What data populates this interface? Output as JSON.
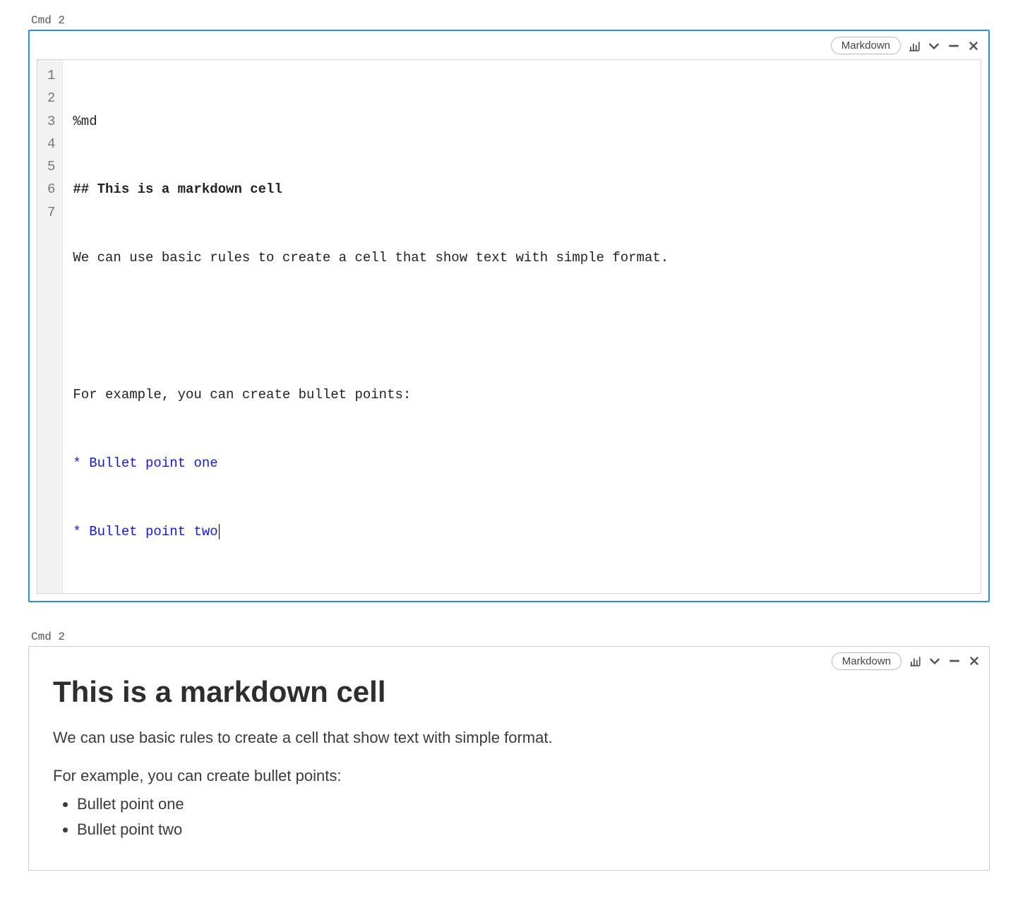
{
  "cell_editor": {
    "label": "Cmd 2",
    "language_selector": "Markdown",
    "lines": {
      "1": "%md",
      "2": "## This is a markdown cell",
      "3": "We can use basic rules to create a cell that show text with simple format.",
      "4": "",
      "5": "For example, you can create bullet points:",
      "6_prefix": "* ",
      "6_text": "Bullet point one",
      "7_prefix": "* ",
      "7_text": "Bullet point two"
    },
    "line_numbers": [
      "1",
      "2",
      "3",
      "4",
      "5",
      "6",
      "7"
    ]
  },
  "cell_rendered": {
    "label": "Cmd 2",
    "language_selector": "Markdown",
    "heading": "This is a markdown cell",
    "paragraph1": "We can use basic rules to create a cell that show text with simple format.",
    "paragraph2": "For example, you can create bullet points:",
    "bullets": {
      "0": "Bullet point one",
      "1": "Bullet point two"
    }
  },
  "icons": {
    "chart": "chart-icon",
    "chevron_down": "chevron-down-icon",
    "minimize": "minimize-icon",
    "close": "close-icon"
  }
}
